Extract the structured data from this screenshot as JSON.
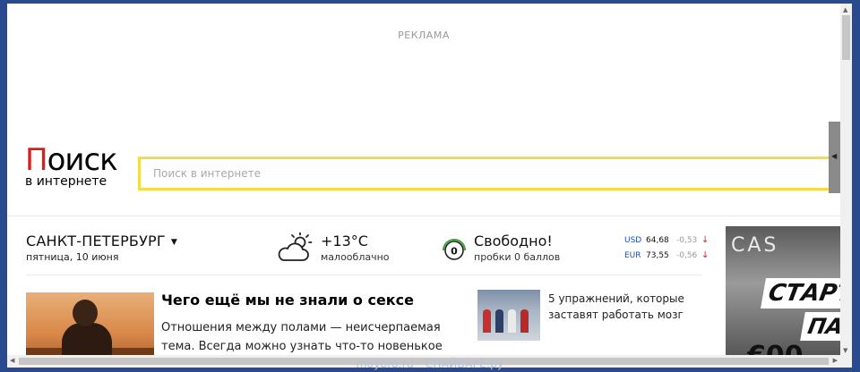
{
  "ad": {
    "label": "РЕКЛАМА"
  },
  "logo": {
    "first_letter": "П",
    "rest": "оиск",
    "subtitle": "в интернете"
  },
  "search": {
    "placeholder": "Поиск в интернете",
    "value": ""
  },
  "side_tab": {
    "icon": "arrow-left-icon",
    "glyph": "◀"
  },
  "city": {
    "name": "САНКТ-ПЕТЕРБУРГ",
    "caret": "▼",
    "date": "пятница, 10 июня"
  },
  "weather": {
    "temp": "+13°C",
    "desc": "малооблачно",
    "icon": "sun-cloud-icon"
  },
  "traffic": {
    "level": "0",
    "status": "Свободно!",
    "desc": "пробки 0 баллов"
  },
  "rates": [
    {
      "currency": "USD",
      "value": "64,68",
      "change": "-0,53",
      "arrow": "↓"
    },
    {
      "currency": "EUR",
      "value": "73,55",
      "change": "-0,56",
      "arrow": "↓"
    }
  ],
  "news": {
    "title": "Чего ещё мы не знали о сексе",
    "text": "Отношения между полами — неисчерпаемая тема. Всегда можно узнать что-то новенькое"
  },
  "side_news": {
    "text": "5 упражнений, которые заставят работать мозг"
  },
  "banner": {
    "brand": "CAS",
    "line1": "СТАРТ",
    "line2": "ПА",
    "line3": "€00"
  },
  "scrollbars": {
    "up": "▲",
    "down": "▼",
    "left": "◀",
    "right": "▶"
  },
  "watermark": "moyoro.ru - СПАЙВАРЕ.ру",
  "colors": {
    "search_border": "#f5dc44",
    "logo_red": "#e21a1a",
    "link_blue": "#1a4fbf",
    "down_red": "#d8232a"
  }
}
